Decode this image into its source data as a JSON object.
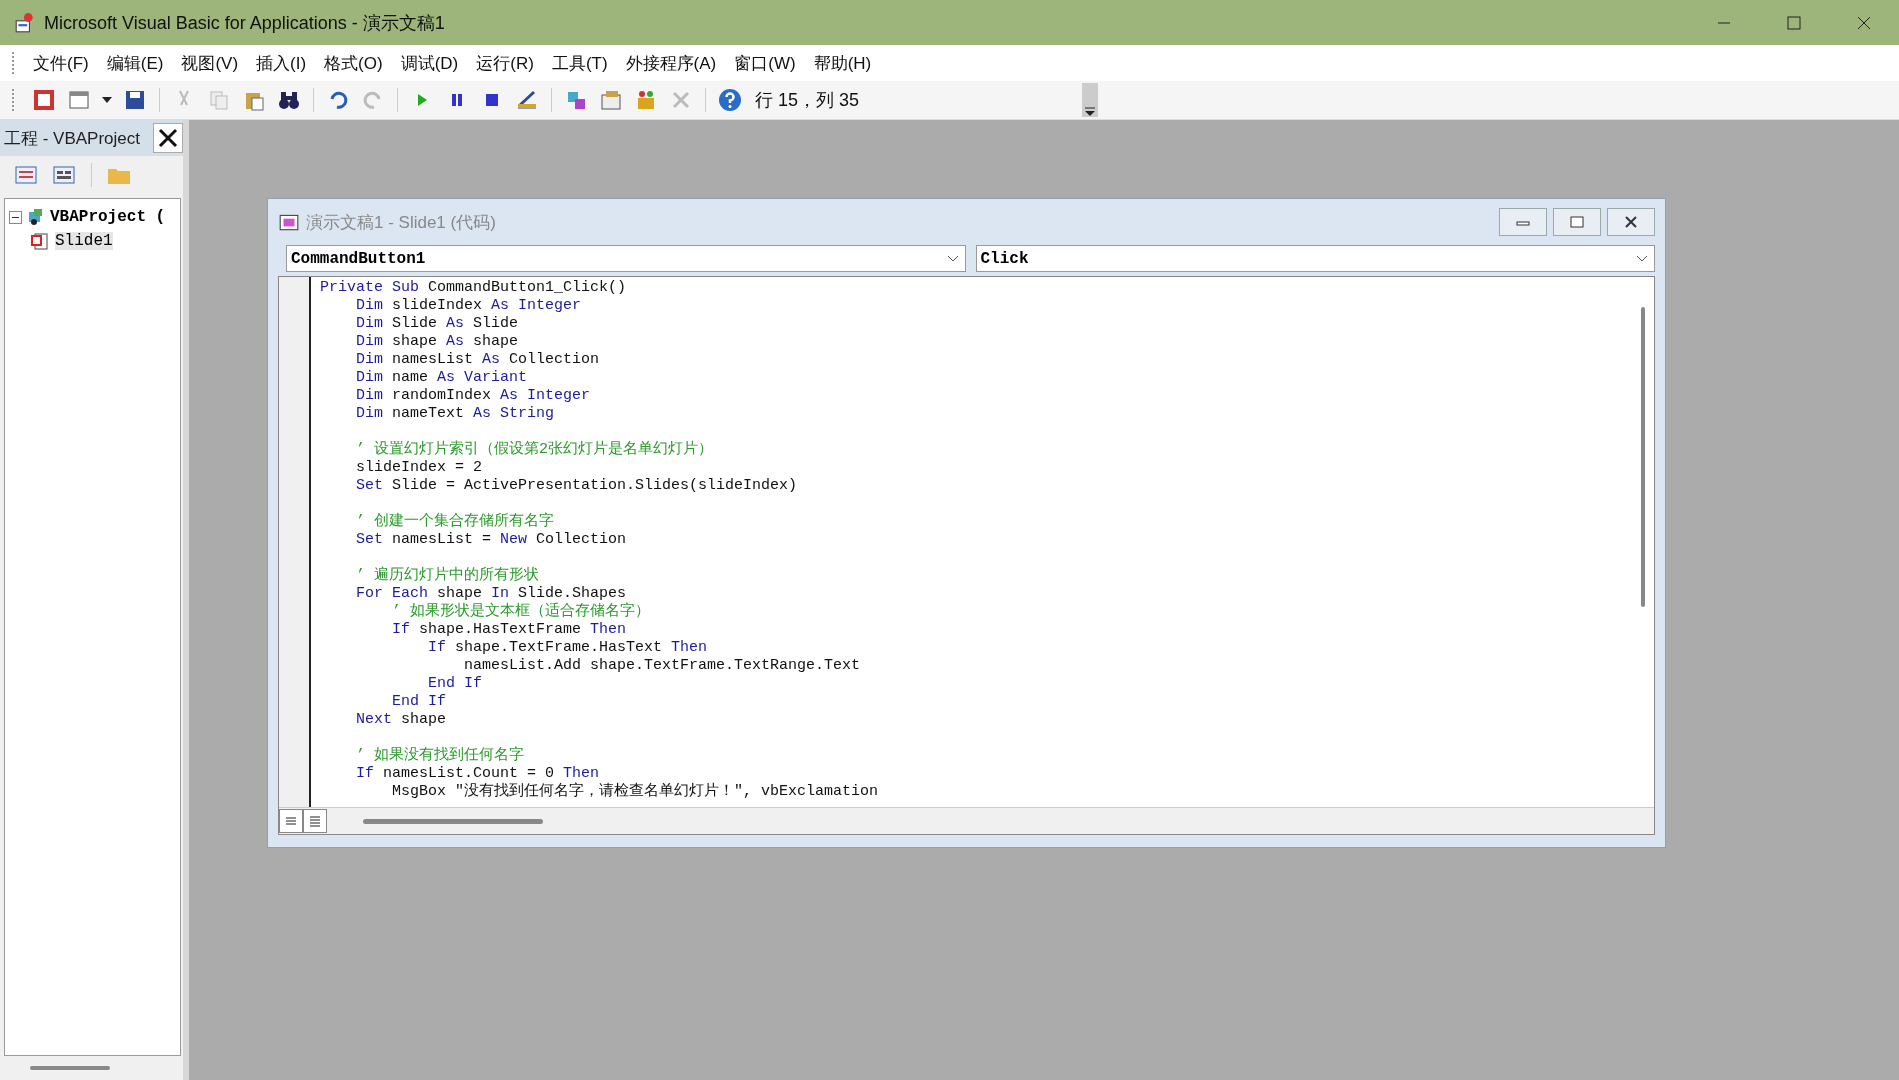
{
  "window": {
    "title": "Microsoft Visual Basic for Applications - 演示文稿1"
  },
  "menu": [
    "文件(F)",
    "编辑(E)",
    "视图(V)",
    "插入(I)",
    "格式(O)",
    "调试(D)",
    "运行(R)",
    "工具(T)",
    "外接程序(A)",
    "窗口(W)",
    "帮助(H)"
  ],
  "toolbar": {
    "position": "行 15，列 35"
  },
  "project_panel": {
    "title": "工程 - VBAProject",
    "tree": [
      {
        "label": "VBAProject (",
        "expanded": true,
        "children": [
          {
            "label": "Slide1",
            "selected": true
          }
        ]
      }
    ]
  },
  "code_window": {
    "title": "演示文稿1 - Slide1 (代码)",
    "object": "CommandButton1",
    "procedure": "Click",
    "lines": [
      {
        "kind": "code",
        "segments": [
          {
            "kind": "keyword",
            "text": "Private Sub"
          },
          {
            "kind": "plain",
            "text": " CommandButton1_Click()"
          }
        ]
      },
      {
        "kind": "code",
        "segments": [
          {
            "kind": "keyword",
            "text": "    Dim"
          },
          {
            "kind": "plain",
            "text": " slideIndex "
          },
          {
            "kind": "keyword",
            "text": "As Integer"
          }
        ]
      },
      {
        "kind": "code",
        "segments": [
          {
            "kind": "keyword",
            "text": "    Dim"
          },
          {
            "kind": "plain",
            "text": " Slide "
          },
          {
            "kind": "keyword",
            "text": "As"
          },
          {
            "kind": "plain",
            "text": " Slide"
          }
        ]
      },
      {
        "kind": "code",
        "segments": [
          {
            "kind": "keyword",
            "text": "    Dim"
          },
          {
            "kind": "plain",
            "text": " shape "
          },
          {
            "kind": "keyword",
            "text": "As"
          },
          {
            "kind": "plain",
            "text": " shape"
          }
        ]
      },
      {
        "kind": "code",
        "segments": [
          {
            "kind": "keyword",
            "text": "    Dim"
          },
          {
            "kind": "plain",
            "text": " namesList "
          },
          {
            "kind": "keyword",
            "text": "As"
          },
          {
            "kind": "plain",
            "text": " Collection"
          }
        ]
      },
      {
        "kind": "code",
        "segments": [
          {
            "kind": "keyword",
            "text": "    Dim"
          },
          {
            "kind": "plain",
            "text": " name "
          },
          {
            "kind": "keyword",
            "text": "As Variant"
          }
        ]
      },
      {
        "kind": "code",
        "segments": [
          {
            "kind": "keyword",
            "text": "    Dim"
          },
          {
            "kind": "plain",
            "text": " randomIndex "
          },
          {
            "kind": "keyword",
            "text": "As Integer"
          }
        ]
      },
      {
        "kind": "code",
        "segments": [
          {
            "kind": "keyword",
            "text": "    Dim"
          },
          {
            "kind": "plain",
            "text": " nameText "
          },
          {
            "kind": "keyword",
            "text": "As String"
          }
        ]
      },
      {
        "kind": "blank"
      },
      {
        "kind": "code",
        "segments": [
          {
            "kind": "comment",
            "text": "    ’ 设置幻灯片索引（假设第2张幻灯片是名单幻灯片）"
          }
        ]
      },
      {
        "kind": "code",
        "segments": [
          {
            "kind": "plain",
            "text": "    slideIndex = 2"
          }
        ]
      },
      {
        "kind": "code",
        "segments": [
          {
            "kind": "keyword",
            "text": "    Set"
          },
          {
            "kind": "plain",
            "text": " Slide = ActivePresentation.Slides(slideIndex)"
          }
        ]
      },
      {
        "kind": "blank"
      },
      {
        "kind": "code",
        "segments": [
          {
            "kind": "comment",
            "text": "    ’ 创建一个集合存储所有名字"
          }
        ]
      },
      {
        "kind": "code",
        "segments": [
          {
            "kind": "keyword",
            "text": "    Set"
          },
          {
            "kind": "plain",
            "text": " namesList = "
          },
          {
            "kind": "keyword",
            "text": "New"
          },
          {
            "kind": "plain",
            "text": " Collection"
          }
        ]
      },
      {
        "kind": "blank"
      },
      {
        "kind": "code",
        "segments": [
          {
            "kind": "comment",
            "text": "    ’ 遍历幻灯片中的所有形状"
          }
        ]
      },
      {
        "kind": "code",
        "segments": [
          {
            "kind": "keyword",
            "text": "    For Each"
          },
          {
            "kind": "plain",
            "text": " shape "
          },
          {
            "kind": "keyword",
            "text": "In"
          },
          {
            "kind": "plain",
            "text": " Slide.Shapes"
          }
        ]
      },
      {
        "kind": "code",
        "segments": [
          {
            "kind": "comment",
            "text": "        ’ 如果形状是文本框（适合存储名字）"
          }
        ]
      },
      {
        "kind": "code",
        "segments": [
          {
            "kind": "keyword",
            "text": "        If"
          },
          {
            "kind": "plain",
            "text": " shape.HasTextFrame "
          },
          {
            "kind": "keyword",
            "text": "Then"
          }
        ]
      },
      {
        "kind": "code",
        "segments": [
          {
            "kind": "keyword",
            "text": "            If"
          },
          {
            "kind": "plain",
            "text": " shape.TextFrame.HasText "
          },
          {
            "kind": "keyword",
            "text": "Then"
          }
        ]
      },
      {
        "kind": "code",
        "segments": [
          {
            "kind": "plain",
            "text": "                namesList.Add shape.TextFrame.TextRange.Text"
          }
        ]
      },
      {
        "kind": "code",
        "segments": [
          {
            "kind": "keyword",
            "text": "            End If"
          }
        ]
      },
      {
        "kind": "code",
        "segments": [
          {
            "kind": "keyword",
            "text": "        End If"
          }
        ]
      },
      {
        "kind": "code",
        "segments": [
          {
            "kind": "keyword",
            "text": "    Next"
          },
          {
            "kind": "plain",
            "text": " shape"
          }
        ]
      },
      {
        "kind": "blank"
      },
      {
        "kind": "code",
        "segments": [
          {
            "kind": "comment",
            "text": "    ’ 如果没有找到任何名字"
          }
        ]
      },
      {
        "kind": "code",
        "segments": [
          {
            "kind": "keyword",
            "text": "    If"
          },
          {
            "kind": "plain",
            "text": " namesList.Count = 0 "
          },
          {
            "kind": "keyword",
            "text": "Then"
          }
        ]
      },
      {
        "kind": "code",
        "segments": [
          {
            "kind": "plain",
            "text": "        MsgBox ″没有找到任何名字，请检查名单幻灯片！″, vbExclamation"
          }
        ]
      }
    ]
  }
}
